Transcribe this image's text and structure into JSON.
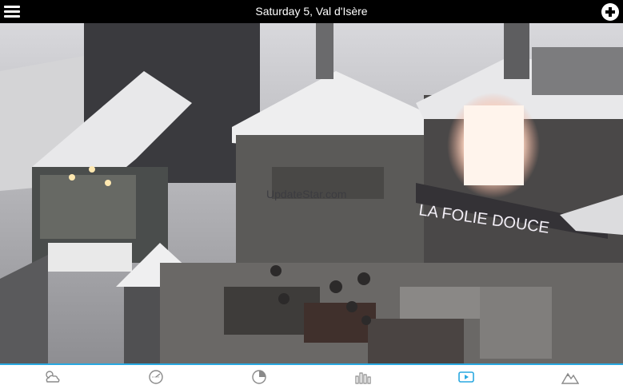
{
  "header": {
    "title": "Saturday 5, Val d'Isère"
  },
  "webcam": {
    "watermark": "UpdateStar.com",
    "sign_text": "LA FOLIE DOUCE"
  },
  "tabs": [
    {
      "name": "forecast",
      "icon": "weather-cloud-sun-icon",
      "active": false
    },
    {
      "name": "snow",
      "icon": "snow-gauge-icon",
      "active": false
    },
    {
      "name": "radar",
      "icon": "radar-icon",
      "active": false
    },
    {
      "name": "charts",
      "icon": "bar-chart-icon",
      "active": false
    },
    {
      "name": "webcam",
      "icon": "video-play-icon",
      "active": true
    },
    {
      "name": "mountain",
      "icon": "mountain-icon",
      "active": false
    }
  ],
  "colors": {
    "accent": "#29a8e0",
    "icon_inactive": "#8a8a8a",
    "icon_active": "#29a8e0"
  }
}
